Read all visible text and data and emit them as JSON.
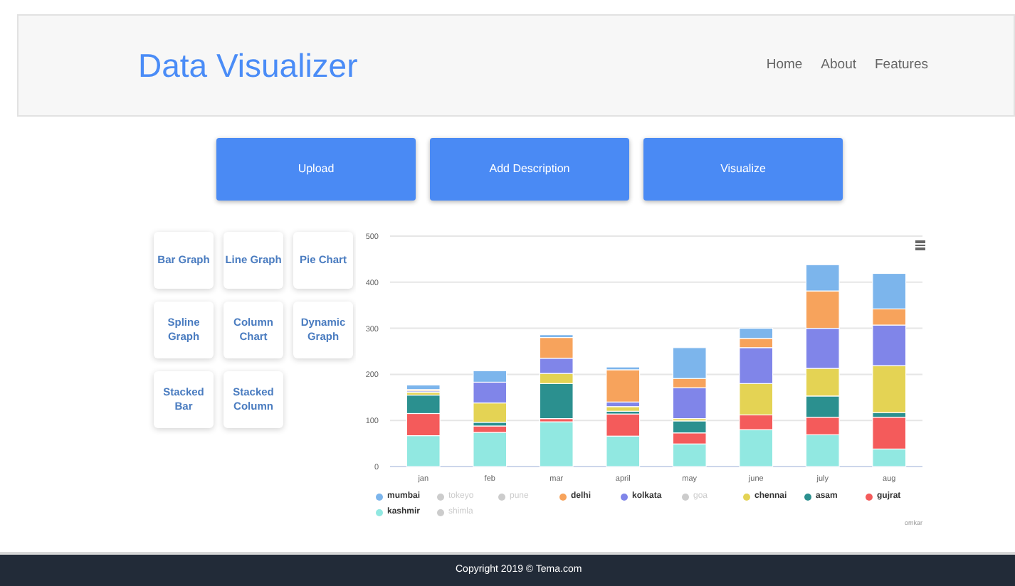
{
  "header": {
    "title": "Data Visualizer",
    "nav": [
      {
        "label": "Home"
      },
      {
        "label": "About"
      },
      {
        "label": "Features"
      }
    ]
  },
  "actions": [
    {
      "label": "Upload"
    },
    {
      "label": "Add Description"
    },
    {
      "label": "Visualize"
    }
  ],
  "chart_types": [
    {
      "label": "Bar Graph"
    },
    {
      "label": "Line Graph"
    },
    {
      "label": "Pie Chart"
    },
    {
      "label": "Spline Graph"
    },
    {
      "label": "Column Chart"
    },
    {
      "label": "Dynamic Graph"
    },
    {
      "label": "Stacked Bar"
    },
    {
      "label": "Stacked Column"
    }
  ],
  "chart": {
    "chart_data": {
      "type": "bar",
      "stacked": true,
      "grid": true,
      "categories": [
        "jan",
        "feb",
        "mar",
        "april",
        "may",
        "june",
        "july",
        "aug"
      ],
      "ylim": [
        0,
        500
      ],
      "yticks": [
        0,
        100,
        200,
        300,
        400,
        500
      ],
      "series": [
        {
          "color": "#7cb5ec",
          "values": [
            10,
            25,
            6,
            6,
            67,
            22,
            57,
            77
          ]
        },
        {
          "color": "#f7a35c",
          "values": [
            3,
            0,
            45,
            70,
            20,
            20,
            81,
            35
          ]
        },
        {
          "color": "#8085e9",
          "values": [
            3,
            45,
            33,
            10,
            67,
            78,
            87,
            88
          ]
        },
        {
          "color": "#e4d354",
          "values": [
            6,
            42,
            22,
            10,
            5,
            68,
            60,
            102
          ]
        },
        {
          "color": "#2b908f",
          "values": [
            40,
            8,
            76,
            6,
            26,
            0,
            46,
            10
          ]
        },
        {
          "color": "#f45b5b",
          "values": [
            48,
            14,
            7,
            48,
            24,
            32,
            38,
            69
          ]
        },
        {
          "color": "#91e8e1",
          "values": [
            67,
            74,
            97,
            66,
            49,
            80,
            69,
            38
          ]
        }
      ]
    },
    "legend": [
      {
        "name": "mumbai",
        "color": "#7cb5ec",
        "visible": true
      },
      {
        "name": "tokeyo",
        "visible": false
      },
      {
        "name": "pune",
        "visible": false
      },
      {
        "name": "delhi",
        "color": "#f7a35c",
        "visible": true
      },
      {
        "name": "kolkata",
        "color": "#8085e9",
        "visible": true
      },
      {
        "name": "goa",
        "visible": false
      },
      {
        "name": "chennai",
        "color": "#e4d354",
        "visible": true
      },
      {
        "name": "asam",
        "color": "#2b908f",
        "visible": true
      },
      {
        "name": "gujrat",
        "color": "#f45b5b",
        "visible": true
      },
      {
        "name": "kashmir",
        "color": "#91e8e1",
        "visible": true
      },
      {
        "name": "shimla",
        "visible": false
      }
    ],
    "credit": "omkar"
  },
  "footer": "Copyright 2019 © Tema.com"
}
